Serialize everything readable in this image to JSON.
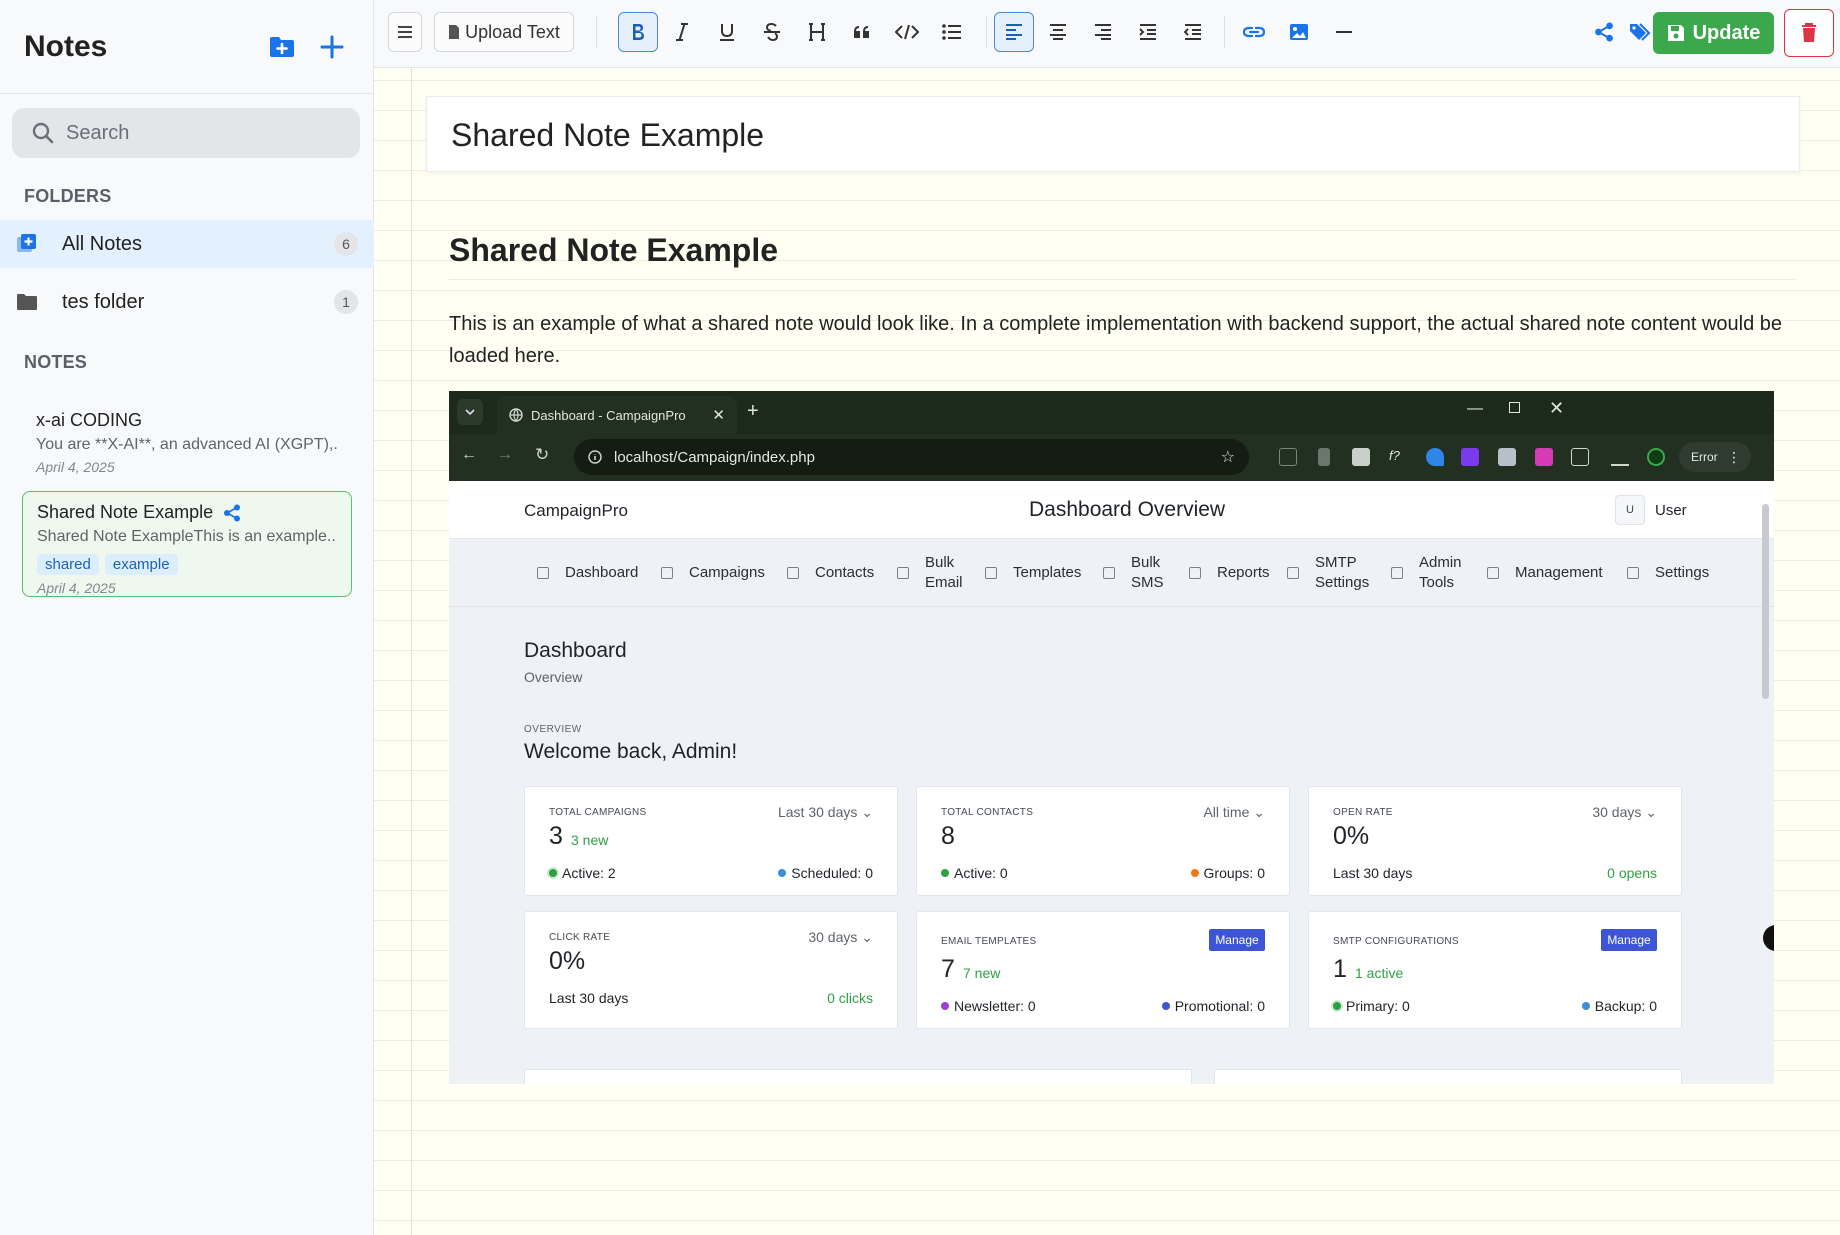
{
  "sidebar": {
    "title": "Notes",
    "search_placeholder": "Search",
    "folders_label": "FOLDERS",
    "folders": [
      {
        "label": "All Notes",
        "count": "6"
      },
      {
        "label": "tes folder",
        "count": "1"
      }
    ],
    "notes_label": "NOTES",
    "notes": [
      {
        "title": "x-ai CODING",
        "snippet": "You are **X-AI**, an advanced AI (XGPT),...",
        "date": "April 4, 2025"
      },
      {
        "title": "Shared Note Example",
        "snippet": "Shared Note ExampleThis is an example...",
        "tags": [
          "shared",
          "example"
        ],
        "date": "April 4, 2025"
      }
    ]
  },
  "toolbar": {
    "upload_label": "Upload Text",
    "update_label": "Update"
  },
  "editor": {
    "title_value": "Shared Note Example",
    "heading": "Shared Note Example",
    "paragraph": "This is an example of what a shared note would look like. In a complete implementation with backend support, the actual shared note content would be loaded here."
  },
  "screenshot": {
    "tab_title": "Dashboard - CampaignPro",
    "url": "localhost/Campaign/index.php",
    "error_label": "Error",
    "brand": "CampaignPro",
    "page_title": "Dashboard Overview",
    "user_initial": "U",
    "user_name": "User",
    "nav": [
      {
        "l1": "Dashboard",
        "l2": ""
      },
      {
        "l1": "Campaigns",
        "l2": ""
      },
      {
        "l1": "Contacts",
        "l2": ""
      },
      {
        "l1": "Bulk",
        "l2": "Email"
      },
      {
        "l1": "Templates",
        "l2": ""
      },
      {
        "l1": "Bulk",
        "l2": "SMS"
      },
      {
        "l1": "Reports",
        "l2": ""
      },
      {
        "l1": "SMTP",
        "l2": "Settings"
      },
      {
        "l1": "Admin",
        "l2": "Tools"
      },
      {
        "l1": "Management",
        "l2": ""
      },
      {
        "l1": "Settings",
        "l2": ""
      }
    ],
    "dashboard_title": "Dashboard",
    "dashboard_sub": "Overview",
    "overview_kicker": "OVERVIEW",
    "welcome": "Welcome back, Admin!",
    "stats": [
      {
        "label": "TOTAL CAMPAIGNS",
        "range": "Last 30 days ⌄",
        "value": "3",
        "new": "3 new",
        "foot_l": "Active: 2",
        "foot_r": "Scheduled: 0"
      },
      {
        "label": "TOTAL CONTACTS",
        "range": "All time ⌄",
        "value": "8",
        "foot_l": "Active: 0",
        "foot_r": "Groups: 0"
      },
      {
        "label": "OPEN RATE",
        "range": "30 days ⌄",
        "value": "0%",
        "foot_l": "Last 30 days",
        "foot_r": "0 opens"
      },
      {
        "label": "CLICK RATE",
        "range": "30 days ⌄",
        "value": "0%",
        "foot_l": "Last 30 days",
        "foot_r": "0 clicks"
      },
      {
        "label": "EMAIL TEMPLATES",
        "button": "Manage",
        "value": "7",
        "new": "7 new",
        "foot_l": "Newsletter: 0",
        "foot_r": "Promotional: 0"
      },
      {
        "label": "SMTP CONFIGURATIONS",
        "button": "Manage",
        "value": "1",
        "new": "1 active",
        "foot_l": "Primary: 0",
        "foot_r": "Backup: 0"
      }
    ]
  },
  "colors": {
    "accent": "#1a73e8",
    "update_green": "#3aa84b",
    "delete_red": "#dc3545",
    "manage_blue": "#3d55d4"
  }
}
